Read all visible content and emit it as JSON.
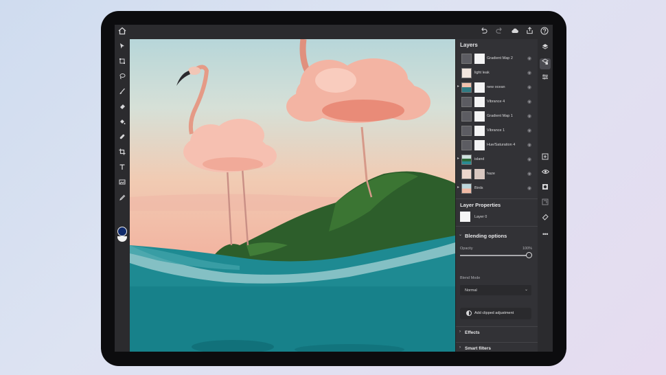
{
  "topbar": {
    "icons": [
      "home-icon",
      "undo-icon",
      "redo-icon",
      "cloud-icon",
      "share-icon",
      "help-icon"
    ]
  },
  "tools": [
    "select-icon",
    "transform-icon",
    "lasso-icon",
    "brush-icon",
    "eraser-icon",
    "fill-icon",
    "healing-icon",
    "crop-icon",
    "type-icon",
    "image-icon",
    "eyedropper-icon"
  ],
  "colors": {
    "foreground": "#0f2a6b",
    "background": "#f2f2f2",
    "panel": "#323236"
  },
  "layers_panel": {
    "title": "Layers",
    "layers": [
      {
        "name": "Gradient Map 2",
        "type": "adjustment"
      },
      {
        "name": "light leak",
        "type": "image"
      },
      {
        "name": "new ocean",
        "type": "image"
      },
      {
        "name": "Vibrance 4",
        "type": "adjustment"
      },
      {
        "name": "Gradient Map 1",
        "type": "adjustment"
      },
      {
        "name": "Vibrance 1",
        "type": "adjustment"
      },
      {
        "name": "Hue/Saturation 4",
        "type": "adjustment"
      },
      {
        "name": "island",
        "type": "image"
      },
      {
        "name": "haze",
        "type": "image"
      },
      {
        "name": "Birds",
        "type": "image"
      }
    ]
  },
  "layer_properties": {
    "title": "Layer Properties",
    "layer_name": "Layer 0",
    "blending_title": "Blending options",
    "opacity_label": "Opacity",
    "opacity_value": "100%",
    "opacity_fraction": 1.0,
    "blend_mode_label": "Blend Mode",
    "blend_mode_value": "Normal",
    "clip_button": "Add clipped adjustment",
    "effects": "Effects",
    "smart_filters": "Smart filters"
  },
  "right_icons": [
    "layers-icon",
    "adjustments-icon",
    "properties-icon",
    "add-layer-icon",
    "visibility-icon",
    "mask-icon",
    "clip-icon",
    "eraser-tag-icon",
    "more-icon"
  ]
}
